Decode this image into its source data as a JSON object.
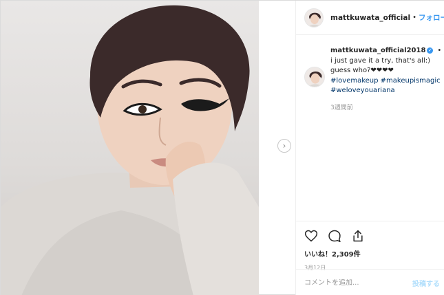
{
  "header": {
    "username": "mattkuwata_official",
    "separator": "•",
    "follow_label": "フォローする"
  },
  "caption": {
    "username": "mattkuwata_official2018",
    "verified_glyph": "✓",
    "more": "•",
    "lines": [
      "i just gave it a try, that's all:)",
      "guess who?❤︎❤︎❤︎❤︎"
    ],
    "hashtags": [
      "#lovemakeup #makeupismagic",
      "#weloveyouariana"
    ],
    "time_ago": "3週間前"
  },
  "engagement": {
    "likes": "いいね！2,309件",
    "date": "3月12日"
  },
  "comment": {
    "placeholder": "コメントを追加...",
    "post_label": "投稿する"
  },
  "icons": {
    "next": "chevron-right-icon",
    "like": "heart-icon",
    "comment": "comment-bubble-icon",
    "share": "share-icon"
  },
  "colors": {
    "link": "#3897f0",
    "hashtag": "#003569",
    "muted": "#999999",
    "post_disabled": "#b2dffc"
  }
}
